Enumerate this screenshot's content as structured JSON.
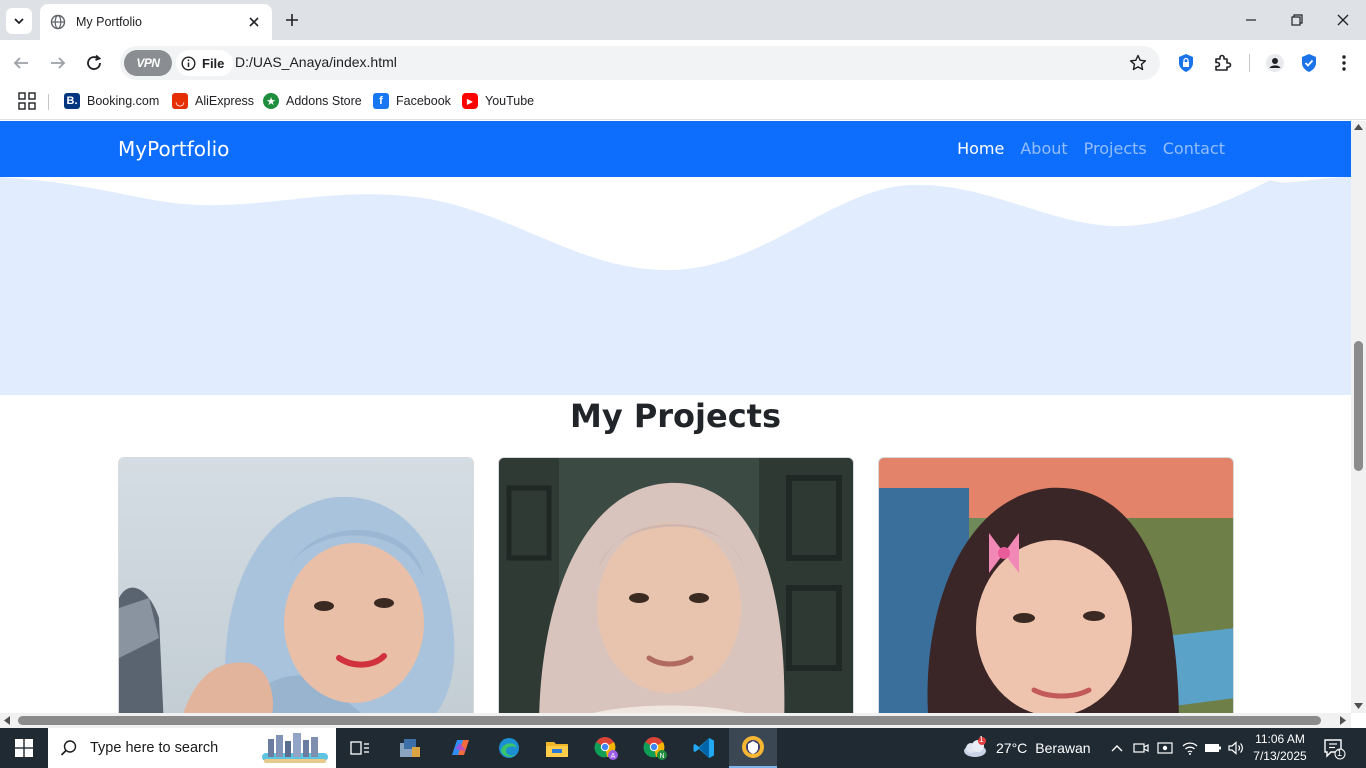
{
  "browser": {
    "tab_title": "My Portfolio",
    "site_chip_label": "File",
    "vpn_label": "VPN",
    "url": "D:/UAS_Anaya/index.html"
  },
  "bookmarks": [
    {
      "label": "Booking.com",
      "icon": "booking-icon",
      "color": "#003580",
      "glyph": "B."
    },
    {
      "label": "AliExpress",
      "icon": "aliexpress-icon",
      "color": "#e62e04",
      "glyph": "◡"
    },
    {
      "label": "Addons Store",
      "icon": "addons-store-icon",
      "color": "#1e8e3e",
      "glyph": "★"
    },
    {
      "label": "Facebook",
      "icon": "facebook-icon",
      "color": "#1877f2",
      "glyph": "f"
    },
    {
      "label": "YouTube",
      "icon": "youtube-icon",
      "color": "#ff0000",
      "glyph": "▶"
    }
  ],
  "page": {
    "brand": "MyPortfolio",
    "nav": [
      {
        "label": "Home",
        "active": true
      },
      {
        "label": "About",
        "active": false
      },
      {
        "label": "Projects",
        "active": false
      },
      {
        "label": "Contact",
        "active": false
      }
    ],
    "projects_title": "My Projects",
    "projects": [
      {
        "image": "portrait-light-blue-hijab-photo"
      },
      {
        "image": "portrait-beige-hijab-photo"
      },
      {
        "image": "portrait-dark-hijab-pink-bow-photo"
      }
    ],
    "colors": {
      "navbar": "#0d6efd",
      "hero": "#e1ecff"
    }
  },
  "taskbar": {
    "search_placeholder": "Type here to search",
    "weather_badge": "1",
    "temperature": "27°C",
    "weather_condition": "Berawan",
    "time": "11:06 AM",
    "date": "7/13/2025",
    "notification_count": "1"
  }
}
